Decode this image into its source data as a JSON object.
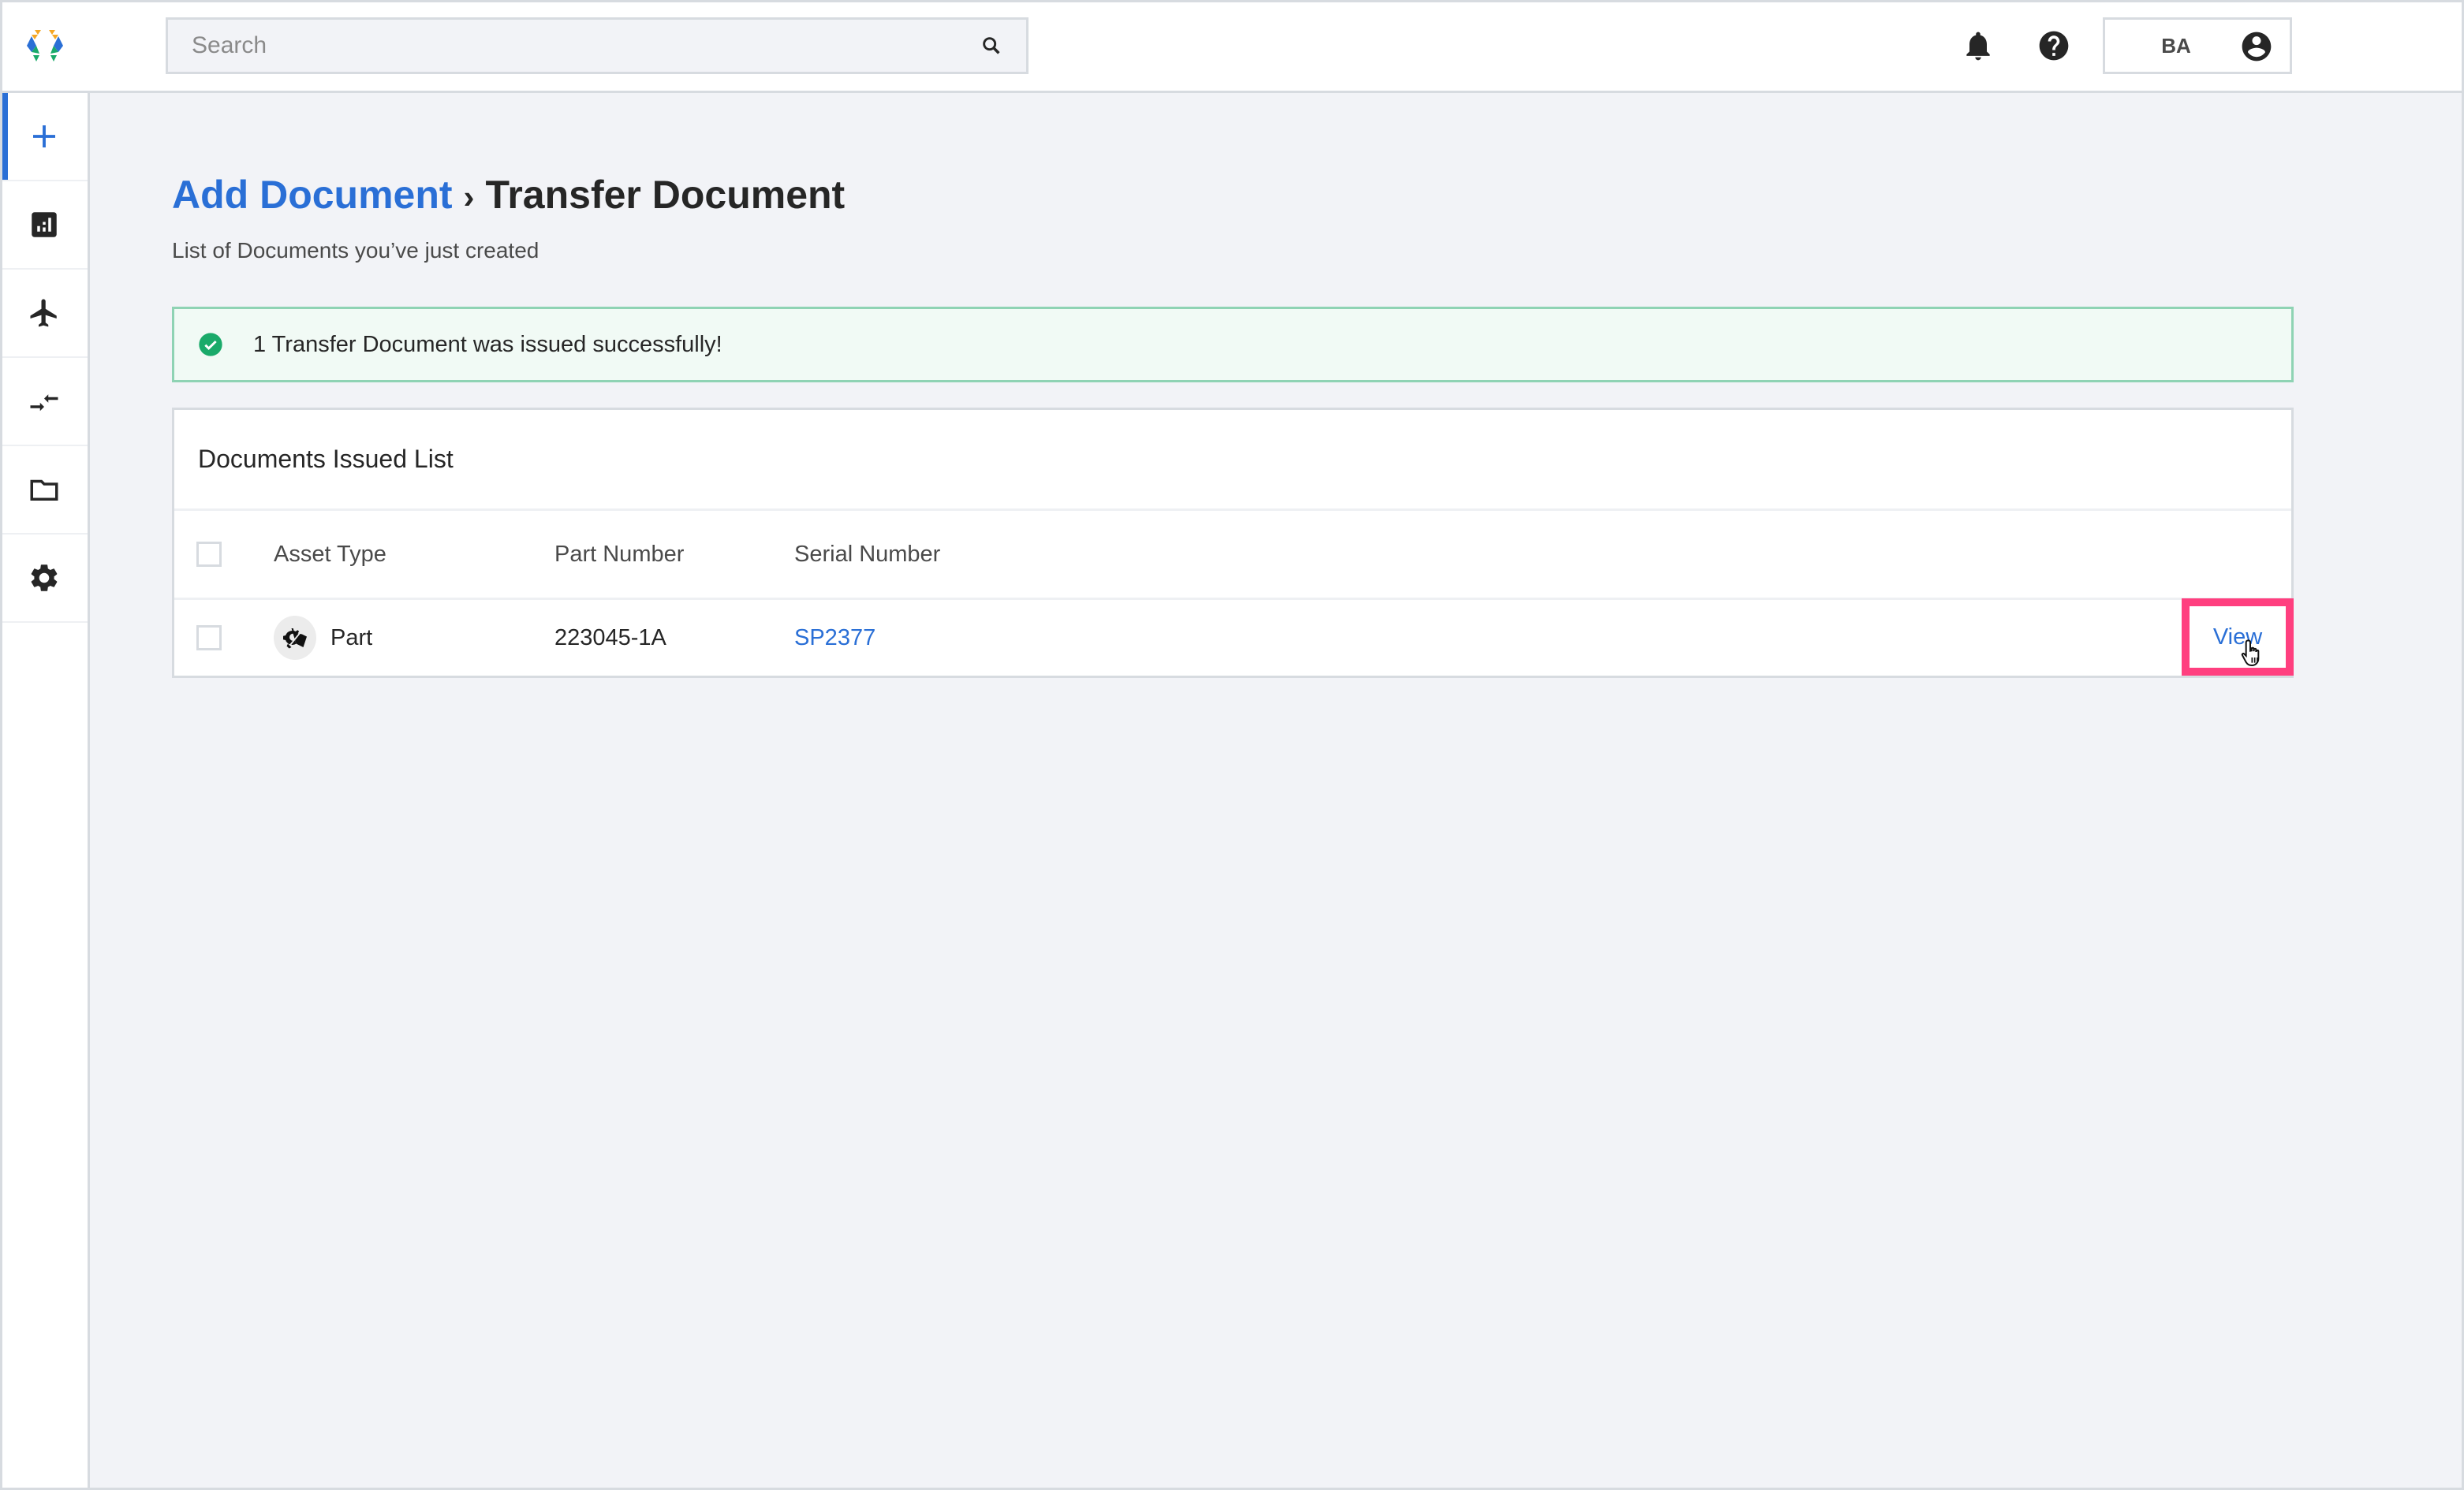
{
  "topbar": {
    "logo": "app-logo",
    "search": {
      "placeholder": "Search",
      "value": "",
      "icon": "search-icon"
    },
    "notifications_icon": "bell-icon",
    "help_icon": "help-circle-icon",
    "user": {
      "initials": "BA",
      "icon": "account-circle-icon"
    }
  },
  "sidebar": {
    "items": [
      {
        "id": "add",
        "icon": "plus-icon",
        "active": true
      },
      {
        "id": "reports",
        "icon": "bar-chart-icon",
        "active": false
      },
      {
        "id": "flights",
        "icon": "airplane-icon",
        "active": false
      },
      {
        "id": "transfers",
        "icon": "transfer-arrows-icon",
        "active": false
      },
      {
        "id": "documents",
        "icon": "folder-icon",
        "active": false
      },
      {
        "id": "settings",
        "icon": "gear-icon",
        "active": false
      }
    ]
  },
  "page": {
    "breadcrumb": {
      "parent": "Add Document",
      "separator": "›",
      "current": "Transfer Document"
    },
    "subtitle": "List of Documents you’ve just created"
  },
  "alert": {
    "type": "success",
    "icon": "check-circle-icon",
    "message": "1 Transfer Document was issued successfully!"
  },
  "table": {
    "title": "Documents Issued List",
    "columns": [
      "Asset Type",
      "Part Number",
      "Serial Number"
    ],
    "rows": [
      {
        "checked": false,
        "asset_icon": "part-gear-icon",
        "asset_type": "Part",
        "part_number": "223045-1A",
        "serial_number": "SP2377",
        "action": "View"
      }
    ]
  },
  "colors": {
    "accent": "#2a6fd6",
    "success": "#1aaa6a",
    "success_bg": "#f1faf5",
    "highlight": "#ff3f7f",
    "background": "#f2f3f7"
  }
}
